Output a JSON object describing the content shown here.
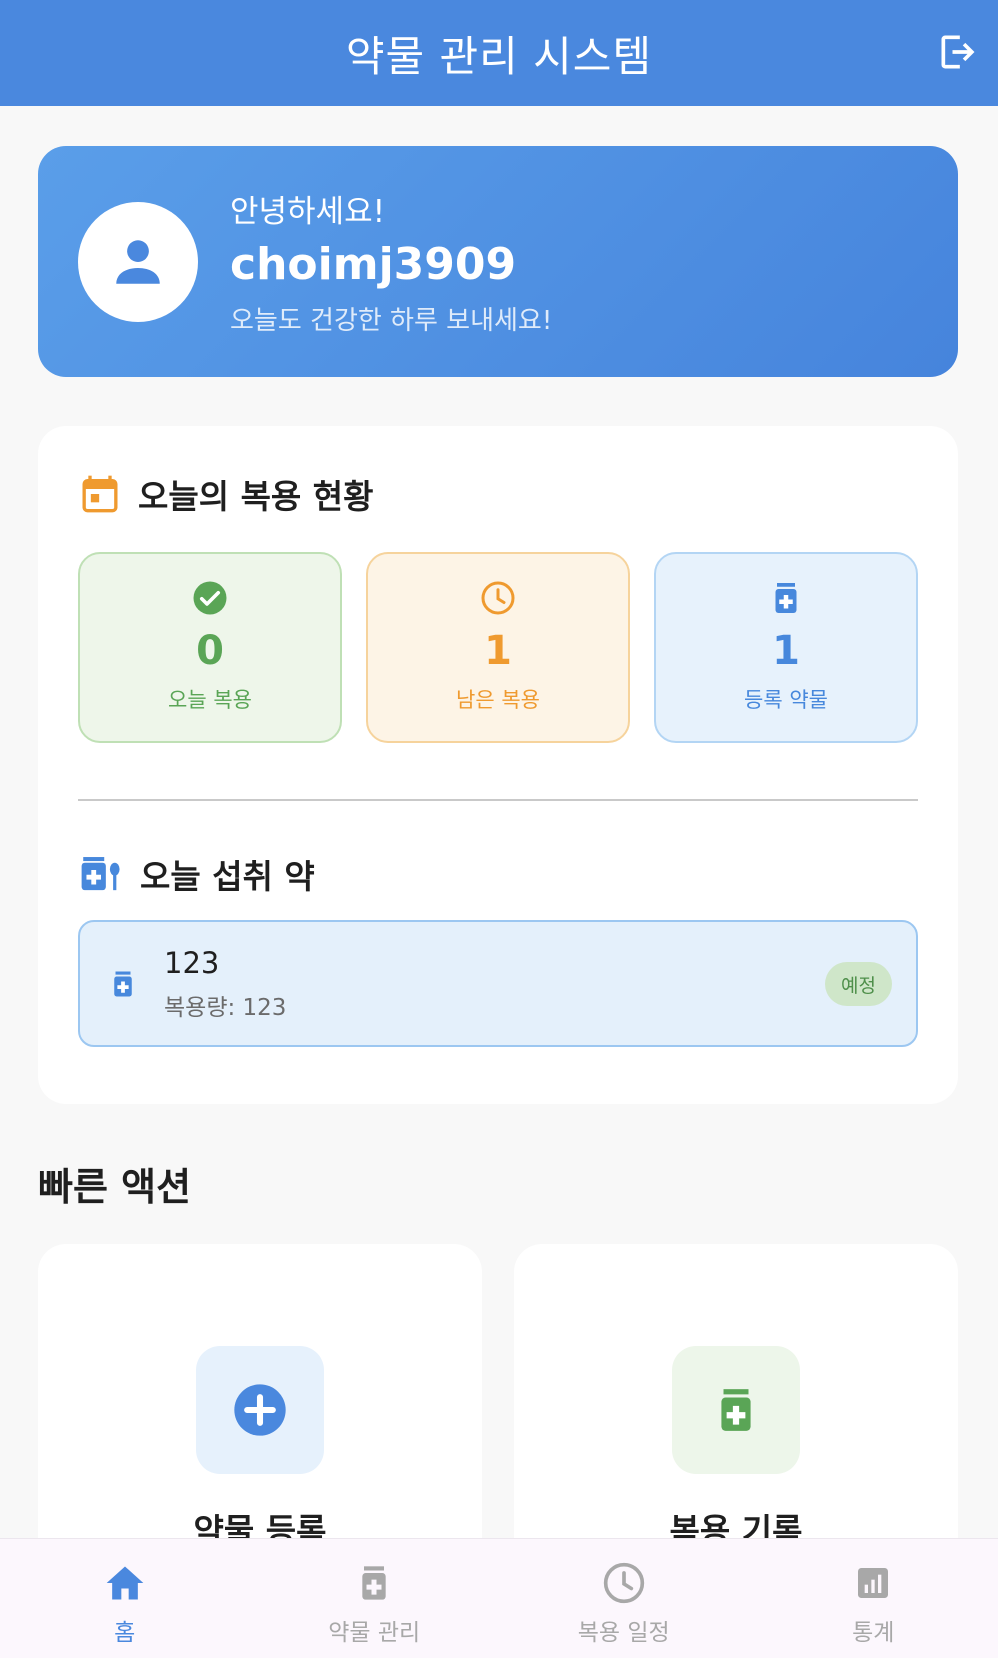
{
  "app_bar": {
    "title": "약물 관리 시스템"
  },
  "greeting": {
    "hello": "안녕하세요!",
    "username": "choimj3909",
    "subtitle": "오늘도 건강한 하루 보내세요!"
  },
  "today_status": {
    "title": "오늘의 복용 현황",
    "stats": [
      {
        "value": "0",
        "label": "오늘 복용",
        "icon": "check-circle-icon",
        "color": "#5aa556"
      },
      {
        "value": "1",
        "label": "남은 복용",
        "icon": "clock-icon",
        "color": "#ef9a2f"
      },
      {
        "value": "1",
        "label": "등록 약물",
        "icon": "medication-icon",
        "color": "#4788dc"
      }
    ]
  },
  "today_meds": {
    "title": "오늘 섭취 약",
    "items": [
      {
        "name": "123",
        "dose": "복용량: 123",
        "status": "예정"
      }
    ]
  },
  "quick_actions": {
    "title": "빠른 액션",
    "items": [
      {
        "label": "약물 등록",
        "icon": "add-circle-icon"
      },
      {
        "label": "복용 기록",
        "icon": "medication-icon"
      }
    ]
  },
  "bottom_nav": {
    "items": [
      {
        "label": "홈",
        "icon": "home-icon",
        "active": true
      },
      {
        "label": "약물 관리",
        "icon": "medication-icon",
        "active": false
      },
      {
        "label": "복용 일정",
        "icon": "clock-icon",
        "active": false
      },
      {
        "label": "통계",
        "icon": "chart-icon",
        "active": false
      }
    ]
  },
  "colors": {
    "primary": "#4a88de",
    "green": "#5aa556",
    "orange": "#ef9a2f",
    "blue": "#4788dc",
    "inactive": "#a8a8a8"
  }
}
